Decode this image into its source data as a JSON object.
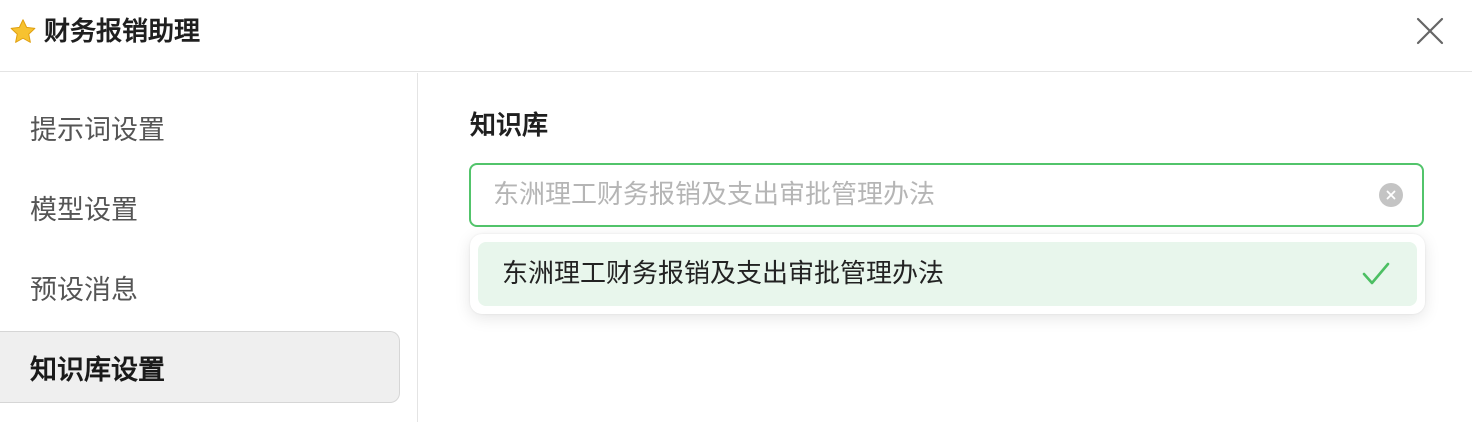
{
  "dialog": {
    "title": "财务报销助理",
    "title_icon": "star-icon",
    "close_icon": "close-icon"
  },
  "sidebar": {
    "items": [
      {
        "label": "提示词设置",
        "active": false
      },
      {
        "label": "模型设置",
        "active": false
      },
      {
        "label": "预设消息",
        "active": false
      },
      {
        "label": "知识库设置",
        "active": true
      }
    ]
  },
  "knowledge": {
    "section_label": "知识库",
    "select_value": "东洲理工财务报销及支出审批管理办法",
    "options": [
      {
        "label": "东洲理工财务报销及支出审批管理办法",
        "selected": true
      }
    ]
  },
  "colors": {
    "accent": "#52c46b",
    "selected_bg": "#e8f6ec",
    "star": "#f5b820"
  }
}
